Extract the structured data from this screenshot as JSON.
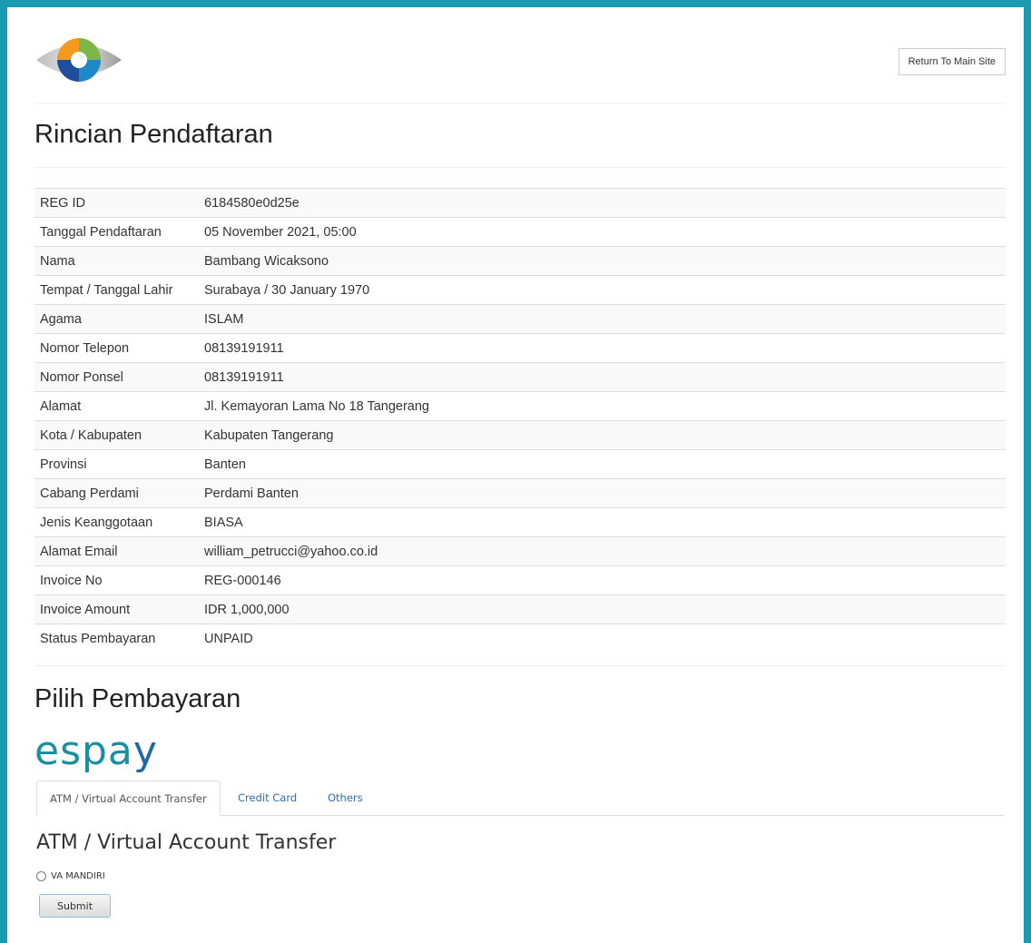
{
  "header": {
    "return_label": "Return To Main Site"
  },
  "registration": {
    "title": "Rincian Pendaftaran",
    "rows": [
      {
        "label": "REG ID",
        "value": "6184580e0d25e"
      },
      {
        "label": "Tanggal Pendaftaran",
        "value": "05 November 2021, 05:00"
      },
      {
        "label": "Nama",
        "value": "Bambang Wicaksono"
      },
      {
        "label": "Tempat / Tanggal Lahir",
        "value": "Surabaya / 30 January 1970"
      },
      {
        "label": "Agama",
        "value": "ISLAM"
      },
      {
        "label": "Nomor Telepon",
        "value": "08139191911"
      },
      {
        "label": "Nomor Ponsel",
        "value": "08139191911"
      },
      {
        "label": "Alamat",
        "value": "Jl. Kemayoran Lama No 18 Tangerang"
      },
      {
        "label": "Kota / Kabupaten",
        "value": "Kabupaten Tangerang"
      },
      {
        "label": "Provinsi",
        "value": "Banten"
      },
      {
        "label": "Cabang Perdami",
        "value": "Perdami Banten"
      },
      {
        "label": "Jenis Keanggotaan",
        "value": "BIASA"
      },
      {
        "label": "Alamat Email",
        "value": "william_petrucci@yahoo.co.id"
      },
      {
        "label": "Invoice No",
        "value": "REG-000146"
      },
      {
        "label": "Invoice Amount",
        "value": "IDR 1,000,000"
      },
      {
        "label": "Status Pembayaran",
        "value": "UNPAID"
      }
    ]
  },
  "payment": {
    "title": "Pilih Pembayaran",
    "brand": {
      "part1": "espa",
      "part2": "y"
    },
    "tabs": [
      {
        "label": "ATM / Virtual Account Transfer"
      },
      {
        "label": "Credit Card"
      },
      {
        "label": "Others"
      }
    ],
    "active_tab_title": "ATM / Virtual Account Transfer",
    "option_label": "VA MANDIRI",
    "submit_label": "Submit"
  },
  "colors": {
    "frame": "#1a9bb0",
    "link": "#2a6fb5",
    "brand": "#1a8fa3"
  }
}
